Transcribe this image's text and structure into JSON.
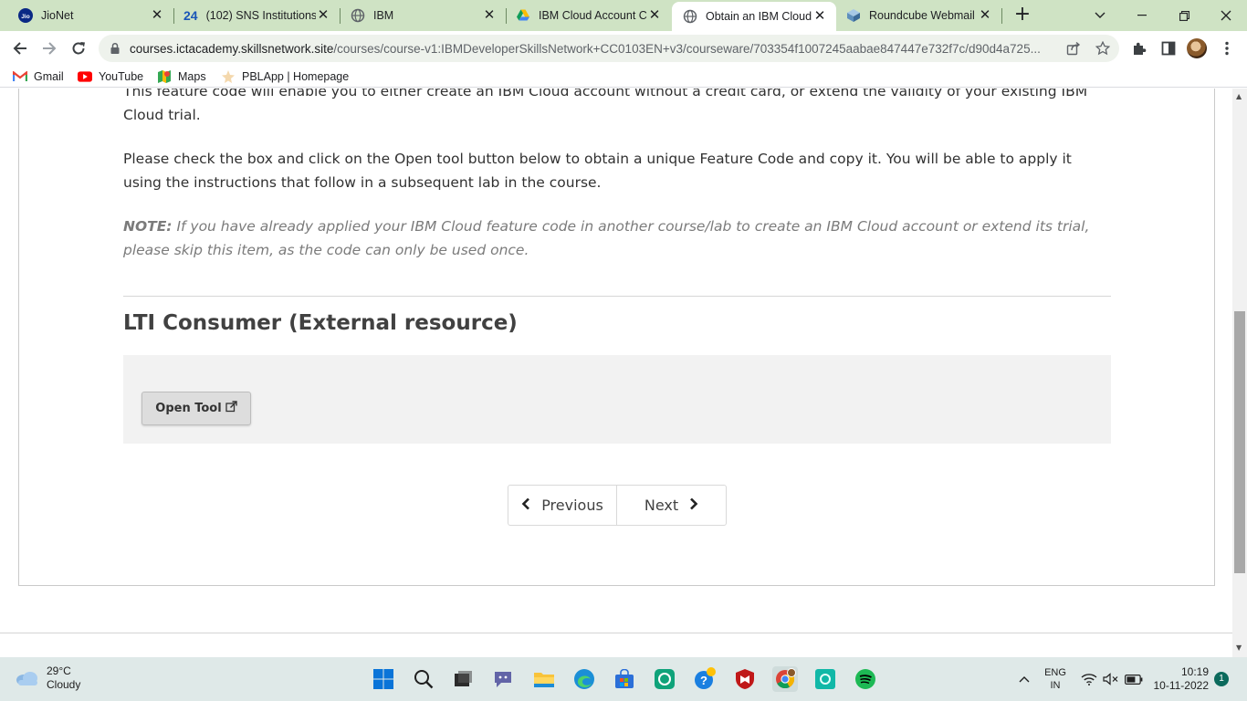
{
  "browser": {
    "tabs": [
      {
        "label": "JioNet",
        "icon": "jio-icon"
      },
      {
        "label": "(102) SNS Institutions",
        "icon": "sns-24-icon",
        "icon_text": "24"
      },
      {
        "label": "IBM",
        "icon": "globe-icon"
      },
      {
        "label": "IBM Cloud Account Cr",
        "icon": "google-drive-icon"
      },
      {
        "label": "Obtain an IBM Cloud F",
        "icon": "globe-icon",
        "active": true
      },
      {
        "label": "Roundcube Webmail ::",
        "icon": "roundcube-icon"
      }
    ],
    "url_host": "courses.ictacademy.skillsnetwork.site",
    "url_path": "/courses/course-v1:IBMDeveloperSkillsNetwork+CC0103EN+v3/courseware/703354f1007245aabae847447e732f7c/d90d4a725...",
    "bookmarks": [
      {
        "label": "Gmail",
        "icon": "gmail-icon"
      },
      {
        "label": "YouTube",
        "icon": "youtube-icon"
      },
      {
        "label": "Maps",
        "icon": "maps-icon"
      },
      {
        "label": "PBLApp | Homepage",
        "icon": "pblapp-icon"
      }
    ]
  },
  "page": {
    "intro_cut": "This feature code will enable you to either create an IBM Cloud account without a credit card, or extend the validity of your existing IBM Cloud trial.",
    "instructions": "Please check the box and click on the Open tool button below to obtain a unique Feature Code and copy it. You will be able to apply it using the instructions that follow in a subsequent lab in the course.",
    "note_label": "NOTE:",
    "note_text": " If you have already applied your IBM Cloud feature code in another course/lab to create an IBM Cloud account or extend its trial, please skip this item, as the code can only be used once.",
    "lti_title": "LTI Consumer (External resource)",
    "open_tool_label": "Open Tool",
    "previous_label": "Previous",
    "next_label": "Next"
  },
  "taskbar": {
    "weather_temp": "29°C",
    "weather_desc": "Cloudy",
    "lang_top": "ENG",
    "lang_bottom": "IN",
    "time": "10:19",
    "date": "10-11-2022",
    "notification_count": "1"
  },
  "colors": {
    "tabstrip": "#cfe3c4",
    "taskbar": "#dfe9e8",
    "note_text": "#7b7b7b"
  }
}
